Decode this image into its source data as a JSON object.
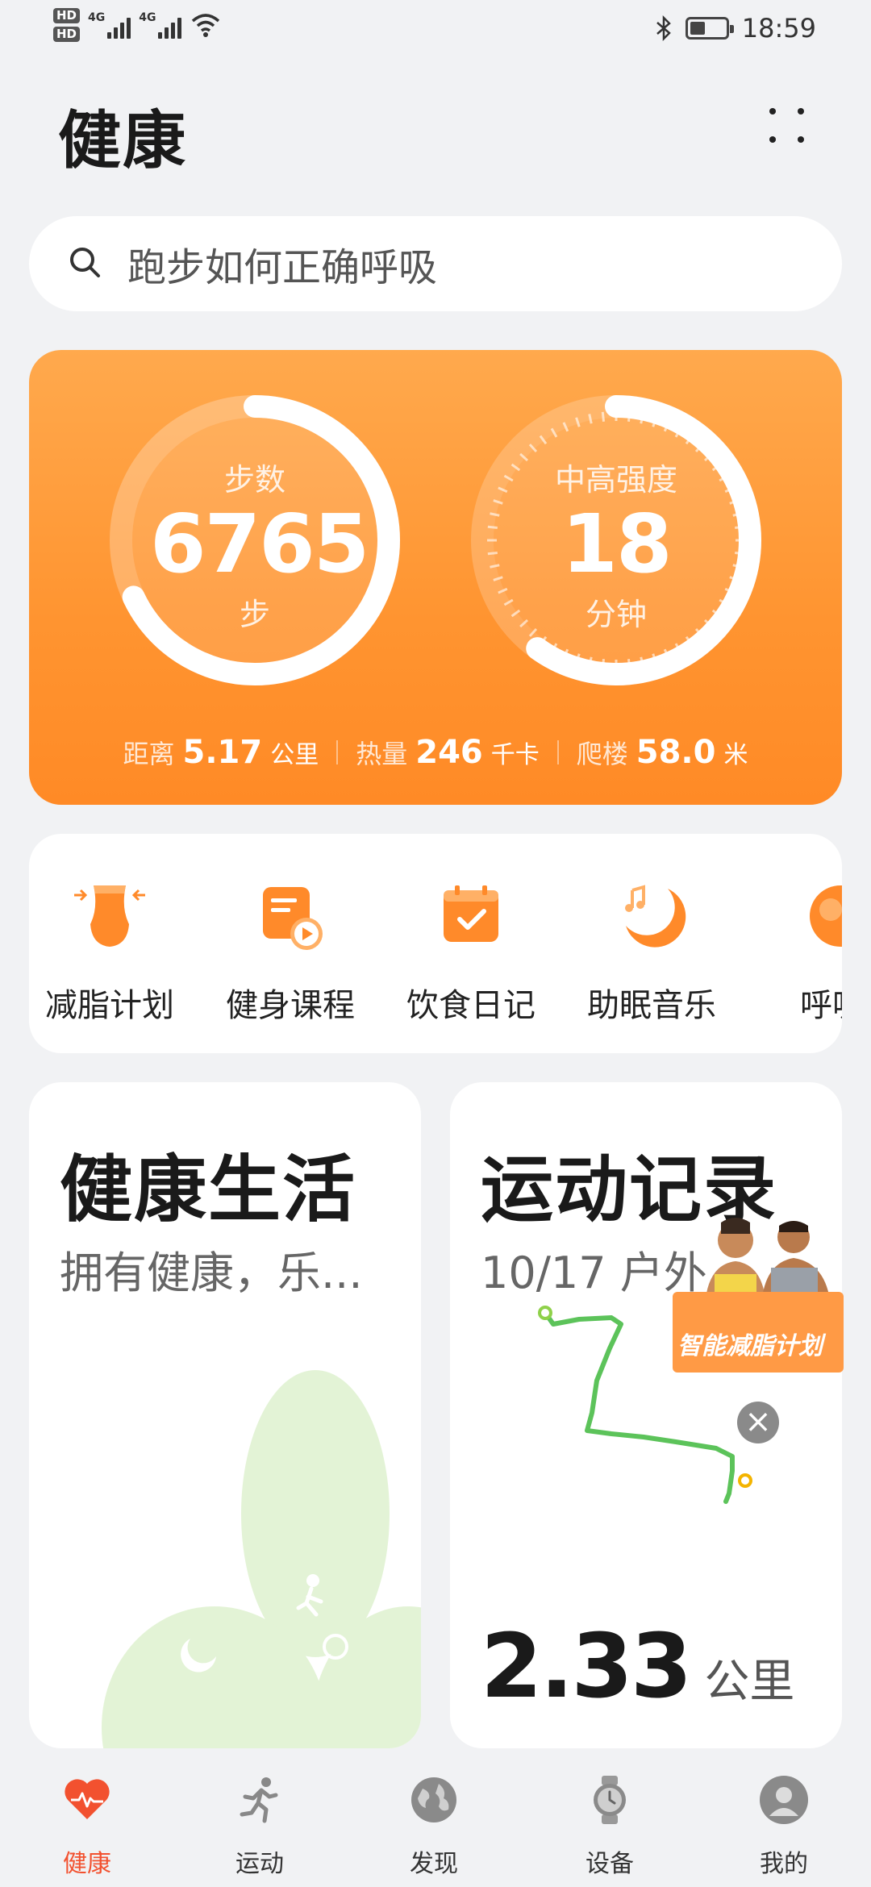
{
  "status_bar": {
    "hd1": "HD",
    "hd2": "HD",
    "sig1": "4G",
    "sig2": "4G",
    "time": "18:59"
  },
  "header": {
    "title": "健康"
  },
  "search": {
    "placeholder": "跑步如何正确呼吸"
  },
  "activity_card": {
    "steps": {
      "label": "步数",
      "value": "6765",
      "unit": "步",
      "progress": 0.68
    },
    "intensity": {
      "label": "中高强度",
      "value": "18",
      "unit": "分钟",
      "progress": 0.6
    },
    "stats": [
      {
        "key": "距离",
        "value": "5.17",
        "unit": "公里"
      },
      {
        "key": "热量",
        "value": "246",
        "unit": "千卡"
      },
      {
        "key": "爬楼",
        "value": "58.0",
        "unit": "米"
      }
    ]
  },
  "tools": [
    {
      "label": "减脂计划",
      "icon": "waist-icon"
    },
    {
      "label": "健身课程",
      "icon": "video-course-icon"
    },
    {
      "label": "饮食日记",
      "icon": "calendar-check-icon"
    },
    {
      "label": "助眠音乐",
      "icon": "moon-music-icon"
    },
    {
      "label": "呼吸",
      "icon": "breath-icon"
    }
  ],
  "cards": {
    "healthy_life": {
      "title": "健康生活",
      "subtitle": "拥有健康，乐..."
    },
    "workout_record": {
      "title": "运动记录",
      "subtitle": "10/17 户外",
      "distance": "2.33",
      "distance_unit": "公里"
    }
  },
  "promo": {
    "text": "智能减脂计划"
  },
  "nav": [
    {
      "label": "健康",
      "icon": "heart-pulse-icon",
      "active": true
    },
    {
      "label": "运动",
      "icon": "running-icon",
      "active": false
    },
    {
      "label": "发现",
      "icon": "globe-icon",
      "active": false
    },
    {
      "label": "设备",
      "icon": "watch-icon",
      "active": false
    },
    {
      "label": "我的",
      "icon": "user-icon",
      "active": false
    }
  ],
  "colors": {
    "accent": "#ff9430",
    "active_nav": "#f2512f",
    "route": "#5cc35a"
  }
}
